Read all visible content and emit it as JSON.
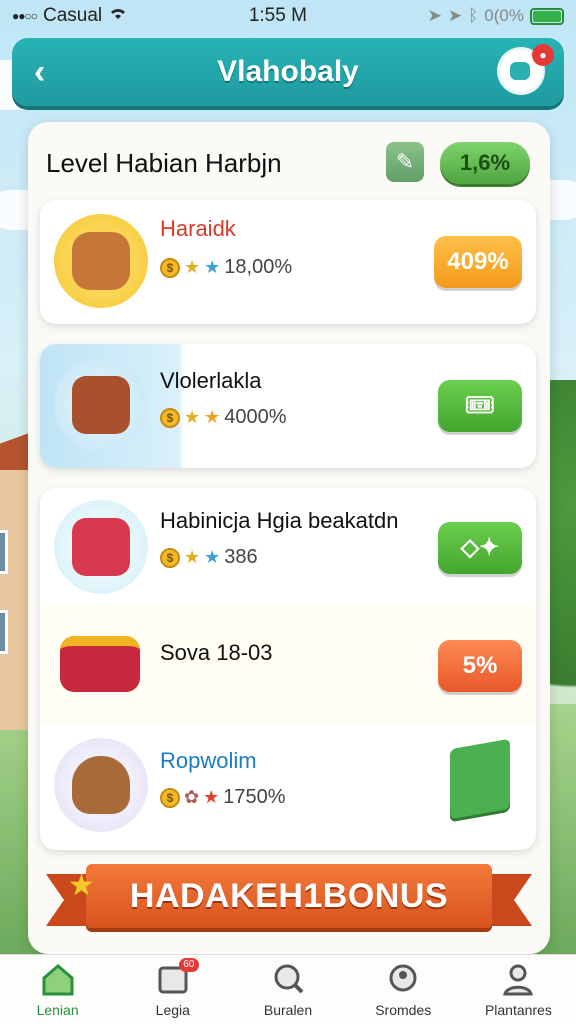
{
  "status_bar": {
    "carrier": "Casual",
    "time": "1:55 M",
    "battery": "0(0%"
  },
  "header": {
    "title": "Vlahobaly"
  },
  "panel": {
    "title": "Level Habian Harbjn",
    "pill": "1,6%"
  },
  "cards": [
    {
      "title": "Haraidk",
      "stat": "18,00%",
      "badge": "409%"
    },
    {
      "title": "Vlolerlakla",
      "stat": "4000%"
    },
    {
      "title": "Habinicja Hgia beakatdn",
      "stat": "386",
      "red_text": "..."
    },
    {
      "title": "Sova 18-03",
      "badge": "5%"
    },
    {
      "title": "Ropwolim",
      "stat": "1750%"
    }
  ],
  "bonus": {
    "label": "HADAKEH1BONUS"
  },
  "nav": [
    {
      "label": "Lenian",
      "icon": "home-icon"
    },
    {
      "label": "Legia",
      "icon": "inbox-icon",
      "badge": "60"
    },
    {
      "label": "Buralen",
      "icon": "search-icon"
    },
    {
      "label": "Sromdes",
      "icon": "location-icon"
    },
    {
      "label": "Plantanres",
      "icon": "profile-icon"
    }
  ],
  "colors": {
    "header": "#1f9aa0",
    "accent_green": "#43a52c",
    "accent_orange": "#f39a1a",
    "accent_red": "#e8592a"
  }
}
